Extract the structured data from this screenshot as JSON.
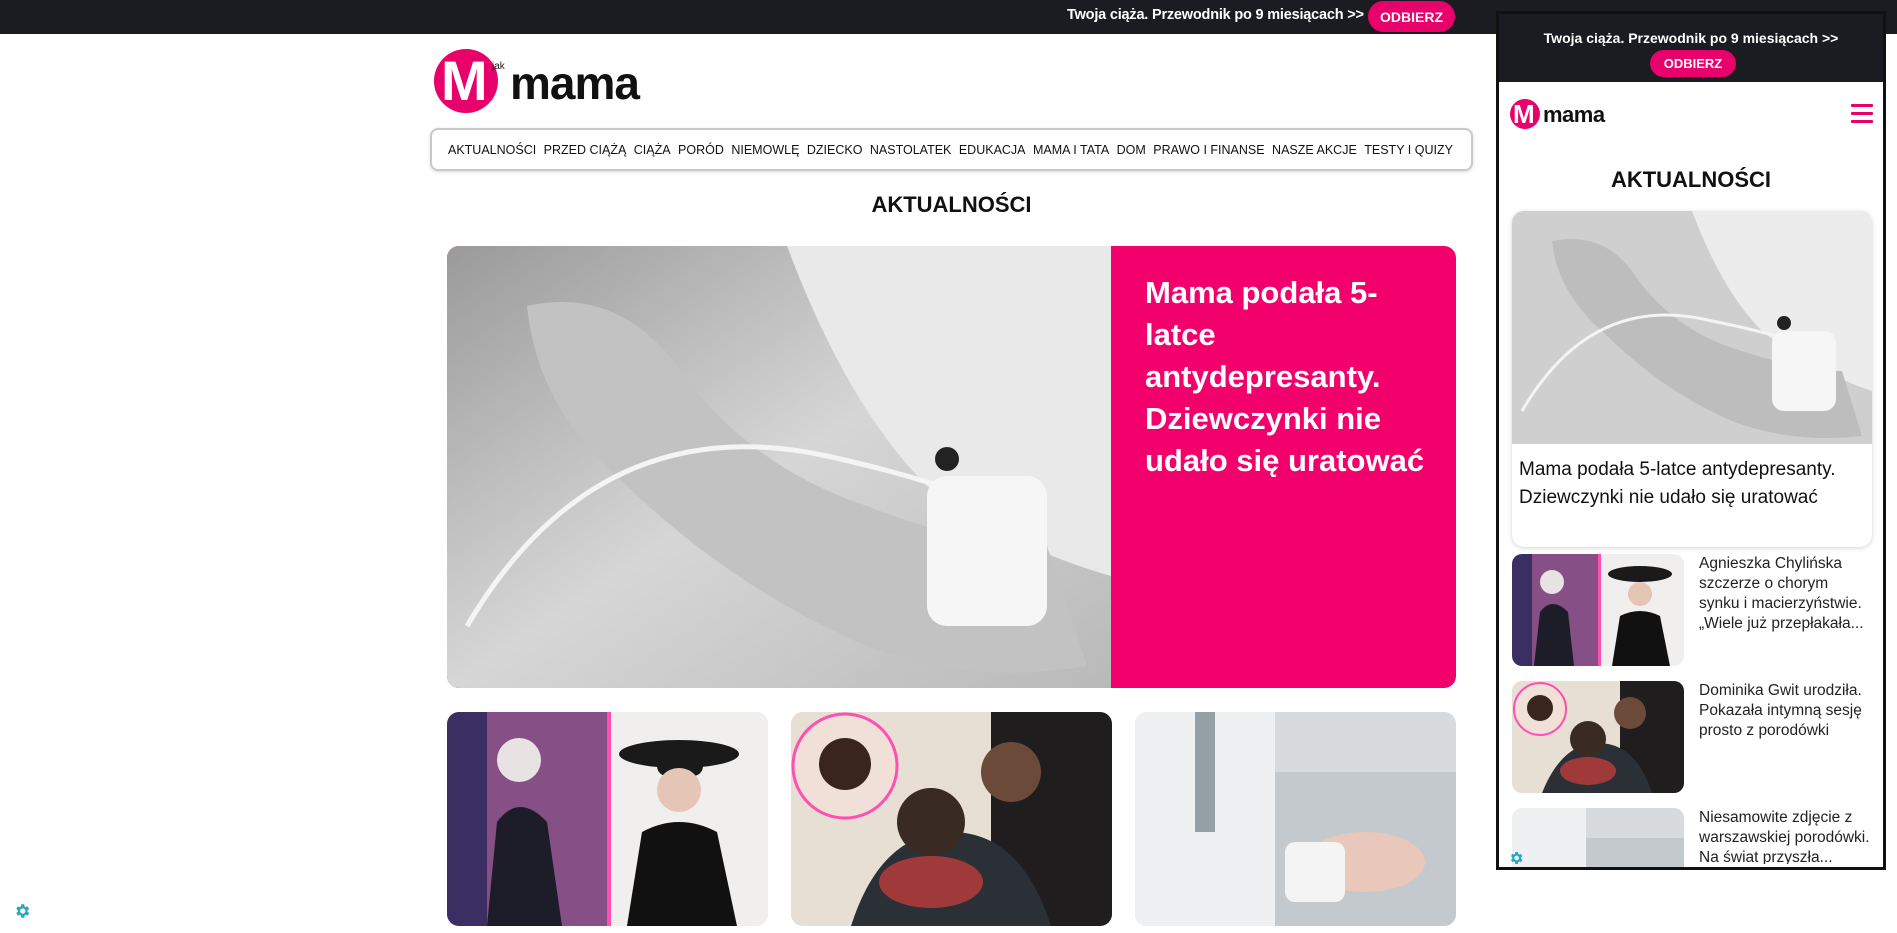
{
  "topbar": {
    "promo_text": "Twoja ciąża. Przewodnik po 9 miesiącach >>",
    "cta_label": "ODBIERZ"
  },
  "logo": {
    "letter": "M",
    "prefix": "jak",
    "word": "mama"
  },
  "nav": {
    "items": [
      "AKTUALNOŚCI",
      "PRZED CIĄŻĄ",
      "CIĄŻA",
      "PORÓD",
      "NIEMOWLĘ",
      "DZIECKO",
      "NASTOLATEK",
      "EDUKACJA",
      "MAMA I TATA",
      "DOM",
      "PRAWO I FINANSE",
      "NASZE AKCJE",
      "TESTY I QUIZY"
    ]
  },
  "section": {
    "title": "AKTUALNOŚCI"
  },
  "hero": {
    "title": "Mama podała 5-latce antydepresanty. Dziewczynki nie udało się uratować"
  },
  "mobile": {
    "promo_text": "Twoja ciąża. Przewodnik po 9 miesiącach >>",
    "cta_label": "ODBIERZ",
    "section_title": "AKTUALNOŚCI",
    "hero_title": "Mama podała 5-latce antydepresanty. Dziewczynki nie udało się uratować",
    "items": [
      {
        "title": "Agnieszka Chylińska szczerze o chorym synku i macierzyństwie. „Wiele już przepłakała..."
      },
      {
        "title": "Dominika Gwit urodziła. Pokazała intymną sesję prosto z porodówki"
      },
      {
        "title": "Niesamowite zdjęcie z warszawskiej porodówki. Na świat przyszła..."
      }
    ]
  },
  "colors": {
    "brand_pink": "#e8006b",
    "dark_bar": "#1b1b22",
    "gear_teal": "#2aa6c0"
  },
  "icons": [
    "gear-icon",
    "hamburger-menu-icon"
  ]
}
